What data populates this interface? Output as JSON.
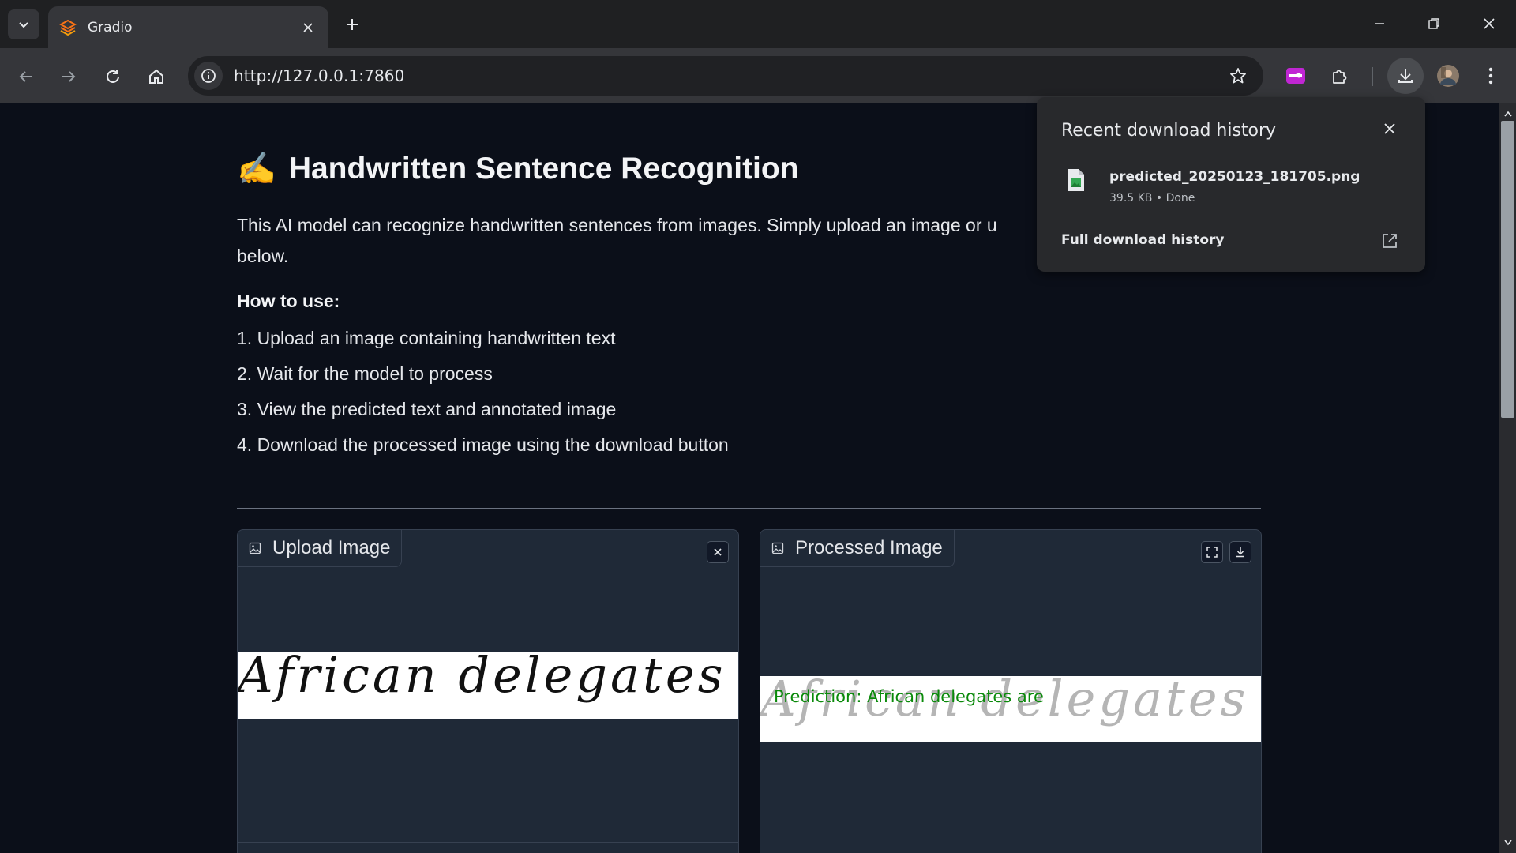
{
  "browser": {
    "tab_title": "Gradio",
    "url": "http://127.0.0.1:7860",
    "accent": "#f97316"
  },
  "page": {
    "title_emoji": "✍️",
    "title": "Handwritten Sentence Recognition",
    "description": "This AI model can recognize handwritten sentences from images. Simply upload an image or u below.",
    "description_line1": "This AI model can recognize handwritten sentences from images. Simply upload an image or u",
    "description_line2": "below.",
    "how_to_heading": "How to use:",
    "steps": [
      "1. Upload an image containing handwritten text",
      "2. Wait for the model to process",
      "3. View the predicted text and annotated image",
      "4. Download the processed image using the download button"
    ]
  },
  "upload_panel": {
    "label": "Upload Image",
    "handwriting": "African delegates are"
  },
  "processed_panel": {
    "label": "Processed Image",
    "prediction": "Prediction: African delegates are",
    "handwriting": "African delegates are"
  },
  "download_popup": {
    "title": "Recent download history",
    "file_name": "predicted_20250123_181705.png",
    "file_meta": "39.5 KB • Done",
    "full_history": "Full download history"
  }
}
